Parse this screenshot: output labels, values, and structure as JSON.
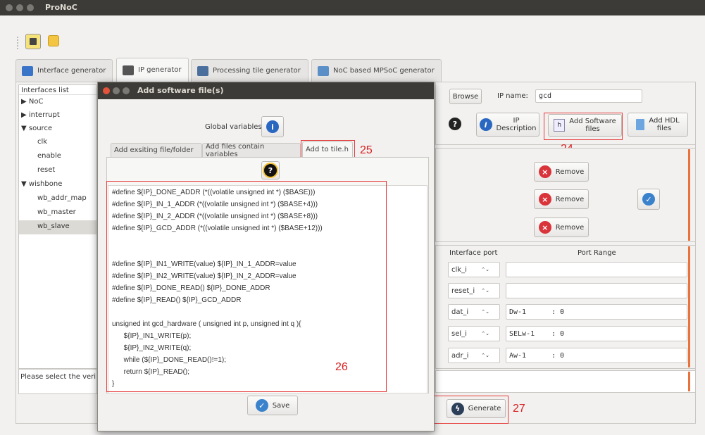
{
  "window": {
    "title": "ProNoC"
  },
  "tabs": [
    {
      "label": "Interface generator"
    },
    {
      "label": "IP generator"
    },
    {
      "label": "Processing tile generator"
    },
    {
      "label": "NoC based MPSoC generator"
    }
  ],
  "interfaces": {
    "header": "Interfaces list",
    "items": [
      {
        "label": "NoC",
        "arrow": "▶"
      },
      {
        "label": "interrupt",
        "arrow": "▶"
      },
      {
        "label": "source",
        "arrow": "▼"
      },
      {
        "label": "clk",
        "arrow": ""
      },
      {
        "label": "enable",
        "arrow": ""
      },
      {
        "label": "reset",
        "arrow": ""
      },
      {
        "label": "wishbone",
        "arrow": "▼"
      },
      {
        "label": "wb_addr_map",
        "arrow": ""
      },
      {
        "label": "wb_master",
        "arrow": ""
      },
      {
        "label": "wb_slave",
        "arrow": ""
      }
    ],
    "status": "Please select the verilo"
  },
  "right": {
    "browse": "Browse",
    "ip_name_label": "IP name:",
    "ip_name_value": "gcd",
    "ip_desc": "IP\nDescription",
    "add_software": "Add Software\nfiles",
    "add_hdl": "Add HDL\nfiles",
    "remove": "Remove",
    "interface_port": "Interface port",
    "port_range": "Port Range",
    "ports": [
      {
        "name": "clk_i",
        "range": "",
        "suffix": ""
      },
      {
        "name": "reset_i",
        "range": "",
        "suffix": ""
      },
      {
        "name": "dat_i",
        "range": "Dw-1",
        "suffix": ": 0"
      },
      {
        "name": "sel_i",
        "range": "SELw-1",
        "suffix": ": 0"
      },
      {
        "name": "adr_i",
        "range": "Aw-1",
        "suffix": ": 0"
      }
    ],
    "generate": "Generate"
  },
  "dialog": {
    "title": "Add software file(s)",
    "global_vars": "Global variables",
    "tabs": [
      {
        "label": "Add exsiting file/folder"
      },
      {
        "label": "Add files contain variables"
      },
      {
        "label": "Add to tile.h"
      }
    ],
    "code_lines": [
      "#define ${IP}_DONE_ADDR (*((volatile unsigned int *) ($BASE)))",
      "#define ${IP}_IN_1_ADDR (*((volatile unsigned int *) ($BASE+4)))",
      "#define ${IP}_IN_2_ADDR (*((volatile unsigned int *) ($BASE+8)))",
      "#define ${IP}_GCD_ADDR (*((volatile unsigned int *) ($BASE+12)))",
      "",
      "",
      "#define ${IP}_IN1_WRITE(value) ${IP}_IN_1_ADDR=value",
      "#define ${IP}_IN2_WRITE(value) ${IP}_IN_2_ADDR=value",
      "#define ${IP}_DONE_READ() ${IP}_DONE_ADDR",
      "#define ${IP}_READ() ${IP}_GCD_ADDR",
      "",
      "unsigned int gcd_hardware ( unsigned int p, unsigned int q ){",
      "      ${IP}_IN1_WRITE(p);",
      "      ${IP}_IN2_WRITE(q);",
      "      while (${IP}_DONE_READ()!=1);",
      "      return ${IP}_READ();",
      "}"
    ],
    "save": "Save"
  },
  "annotations": {
    "a24": "24",
    "a25": "25",
    "a26": "26",
    "a27": "27"
  },
  "colors": {
    "accent_red": "#e53a3a",
    "titlebar": "#3c3b37",
    "orange": "#e8733c"
  }
}
